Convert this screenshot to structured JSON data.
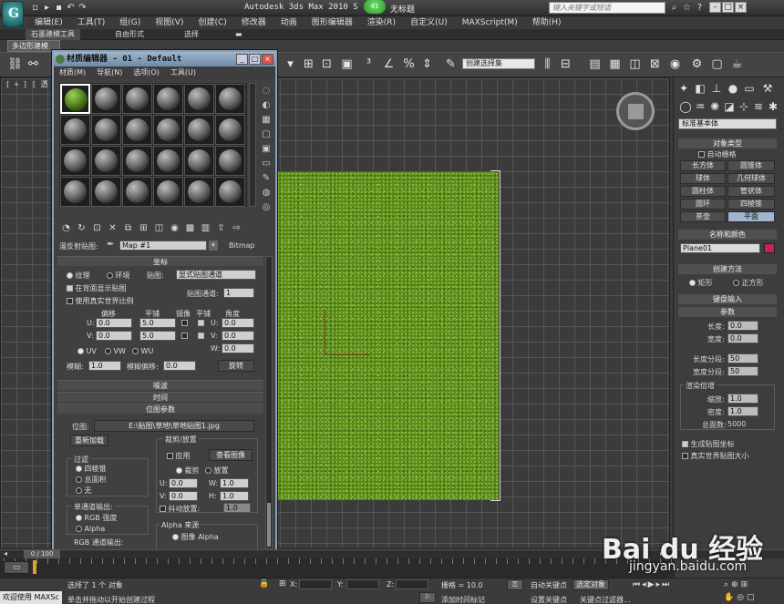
{
  "app": {
    "title": "Autodesk 3ds Max  2010 S",
    "badge": "41",
    "document": "无标题",
    "search_placeholder": "键入关键字或短语",
    "logo_letter": "G"
  },
  "menus": [
    "编辑(E)",
    "工具(T)",
    "组(G)",
    "视图(V)",
    "创建(C)",
    "修改器",
    "动画",
    "图形编辑器",
    "渲染(R)",
    "自定义(U)",
    "MAXScript(M)",
    "帮助(H)"
  ],
  "ribbon": {
    "tabs": [
      "石墨建模工具",
      "自由形式",
      "选择"
    ],
    "subtab": "多边形建模"
  },
  "toolbar": {
    "selection_filter": "创建选择集"
  },
  "viewport": {
    "label": "[ + ] [ 透 ] [ 真 ]"
  },
  "material_editor": {
    "title": "材质编辑器 - 01 - Default",
    "menu": [
      "材质(M)",
      "导航(N)",
      "选项(O)",
      "工具(U)"
    ],
    "map_label": "漫反射贴图:",
    "map_name": "Map #1",
    "map_type": "Bitmap",
    "coords": {
      "header": "坐标",
      "texture": "纹理",
      "environ": "环境",
      "mapping_label": "贴图:",
      "mapping_value": "显式贴图通道",
      "show_back": "在背面显示贴图",
      "channel_label": "贴图通道:",
      "channel_value": "1",
      "real_world": "使用真实世界比例",
      "offset": "偏移",
      "tiling": "平铺",
      "mirror": "镜像",
      "tile": "平铺",
      "angle": "角度",
      "u": "U:",
      "v": "V:",
      "w": "W:",
      "u_offset": "0.0",
      "v_offset": "0.0",
      "u_tiling": "5.0",
      "v_tiling": "5.0",
      "u_angle": "0.0",
      "v_angle": "0.0",
      "w_angle": "0.0",
      "uv": "UV",
      "vw": "VW",
      "wu": "WU",
      "blur_label": "模糊:",
      "blur_value": "1.0",
      "blur_offset_label": "模糊偏移:",
      "blur_offset_value": "0.0",
      "rotate_btn": "旋转"
    },
    "rollouts": [
      "噪波",
      "时间",
      "位图参数"
    ],
    "bitmap": {
      "path_label": "位图:",
      "path": "E:\\贴图\\草地\\草地贴图1.jpg",
      "reload": "重新加载",
      "crop_group": "裁剪/放置",
      "apply": "应用",
      "view_image": "查看图像",
      "crop": "裁剪",
      "place": "放置",
      "u": "U:",
      "v": "V:",
      "w": "W:",
      "h": "H:",
      "u_value": "0.0",
      "v_value": "0.0",
      "w_value": "1.0",
      "h_value": "1.0",
      "jitter": "抖动放置:",
      "jitter_value": "1.0",
      "filter_group": "过滤",
      "filter_1": "四棱锥",
      "filter_2": "总面积",
      "filter_3": "无",
      "mono_group": "单通道输出:",
      "mono_1": "RGB 强度",
      "mono_2": "Alpha",
      "rgb_group": "RGB 通道输出:",
      "alpha_group": "Alpha 来源",
      "alpha_1": "图像 Alpha"
    }
  },
  "command_panel": {
    "category_dropdown": "标准基本体",
    "object_type_header": "对象类型",
    "auto_grid": "自动栅格",
    "buttons": [
      "长方体",
      "圆锥体",
      "球体",
      "几何球体",
      "圆柱体",
      "管状体",
      "圆环",
      "四棱锥",
      "茶壶",
      "平面"
    ],
    "active_button": "平面",
    "name_color_header": "名称和颜色",
    "object_name": "Plane01",
    "object_color": "#c0245a",
    "creation_method_header": "创建方法",
    "method_1": "矩形",
    "method_2": "正方形",
    "keyboard_header": "键盘输入",
    "params_header": "参数",
    "length_label": "长度:",
    "length_value": "0.0",
    "width_label": "宽度:",
    "width_value": "0.0",
    "length_segs_label": "长度分段:",
    "length_segs_value": "50",
    "width_segs_label": "宽度分段:",
    "width_segs_value": "50",
    "render_mult": "渲染倍增",
    "scale_label": "缩放:",
    "scale_value": "1.0",
    "density_label": "密度:",
    "density_value": "1.0",
    "total_faces_label": "总面数:",
    "total_faces_value": "5000",
    "gen_coords": "生成贴图坐标",
    "real_world_size": "真实世界贴图大小"
  },
  "timeline": {
    "slider": "0 / 100"
  },
  "status": {
    "selection": "选择了 1 个 对象",
    "prompt": "单击并拖动以开始创建过程",
    "x_label": "X:",
    "y_label": "Y:",
    "z_label": "Z:",
    "grid": "栅格 = 10.0",
    "auto_key": "自动关键点",
    "selected": "选定对象",
    "set_key": "设置关键点",
    "key_filter": "关键点过滤器...",
    "add_time_tag": "添加时间标记",
    "welcome": "欢迎使用 MAXSc"
  },
  "watermark": {
    "brand": "Bai du 经验",
    "url": "jingyan.baidu.com"
  }
}
